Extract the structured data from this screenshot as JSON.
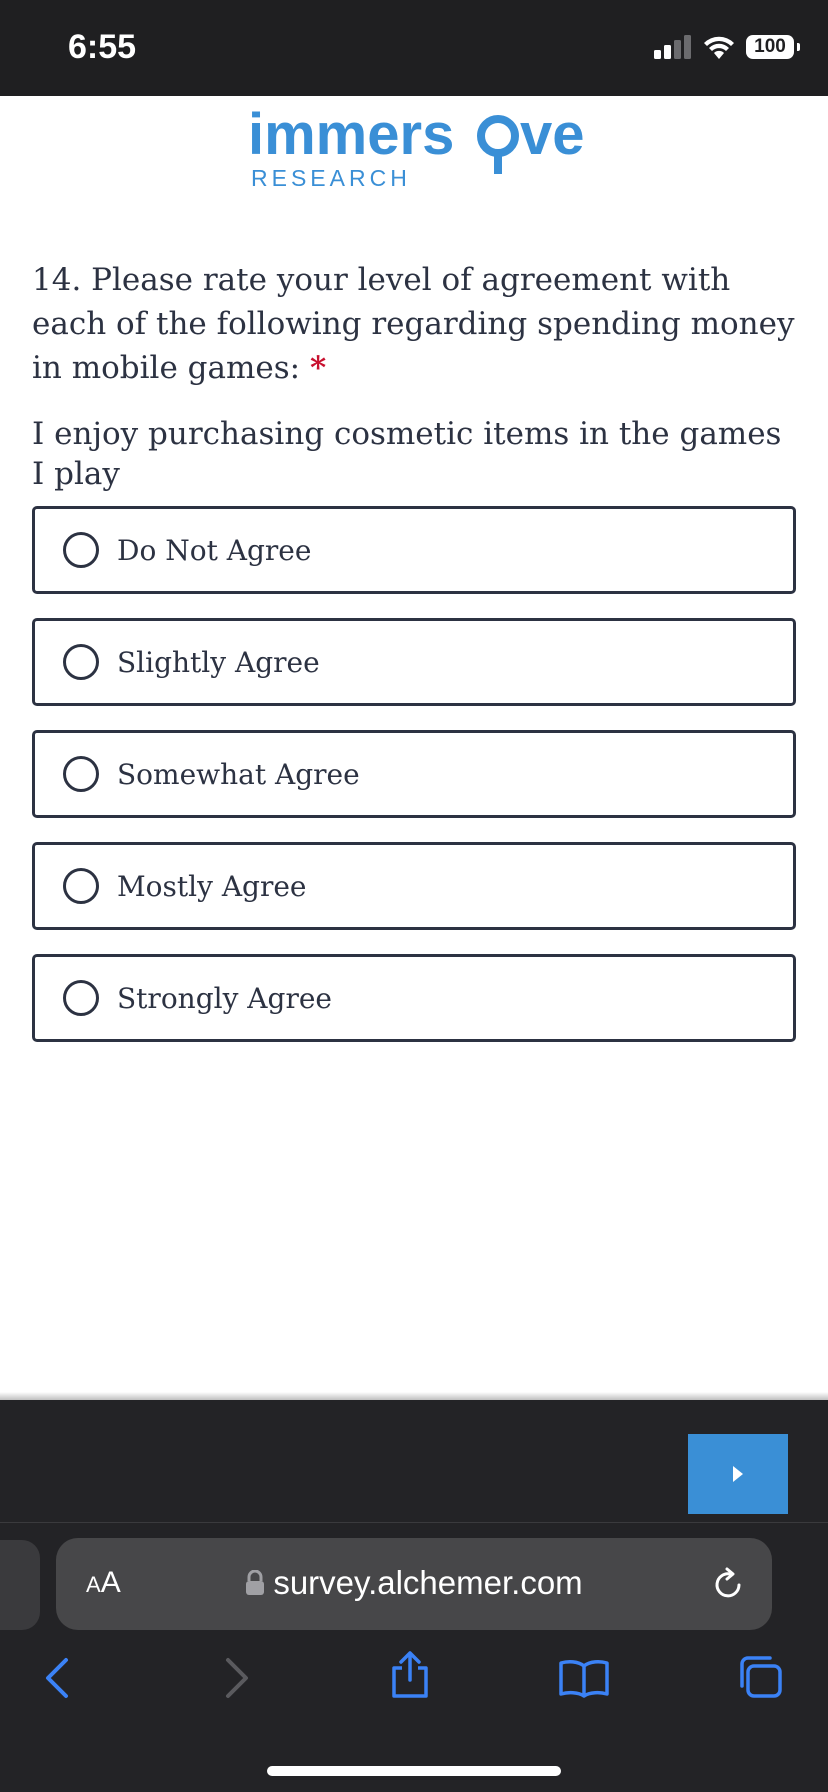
{
  "status_bar": {
    "time": "6:55",
    "battery": "100"
  },
  "logo": {
    "brand": "immersive",
    "subtitle": "RESEARCH"
  },
  "question": {
    "text": "14. Please rate your level of agreement with each of the following regarding spending money in mobile games:",
    "required_mark": "*",
    "statement": "I enjoy purchasing cosmetic items in the games I play"
  },
  "options": [
    {
      "label": "Do Not Agree"
    },
    {
      "label": "Slightly Agree"
    },
    {
      "label": "Somewhat Agree"
    },
    {
      "label": "Mostly Agree"
    },
    {
      "label": "Strongly Agree"
    }
  ],
  "browser": {
    "text_size_small": "A",
    "text_size_big": "A",
    "url": "survey.alchemer.com"
  },
  "colors": {
    "accent": "#3a8fd6",
    "text": "#2c3242",
    "required": "#c8102e",
    "chrome_bg": "#232326",
    "ios_blue": "#3b82f6"
  }
}
